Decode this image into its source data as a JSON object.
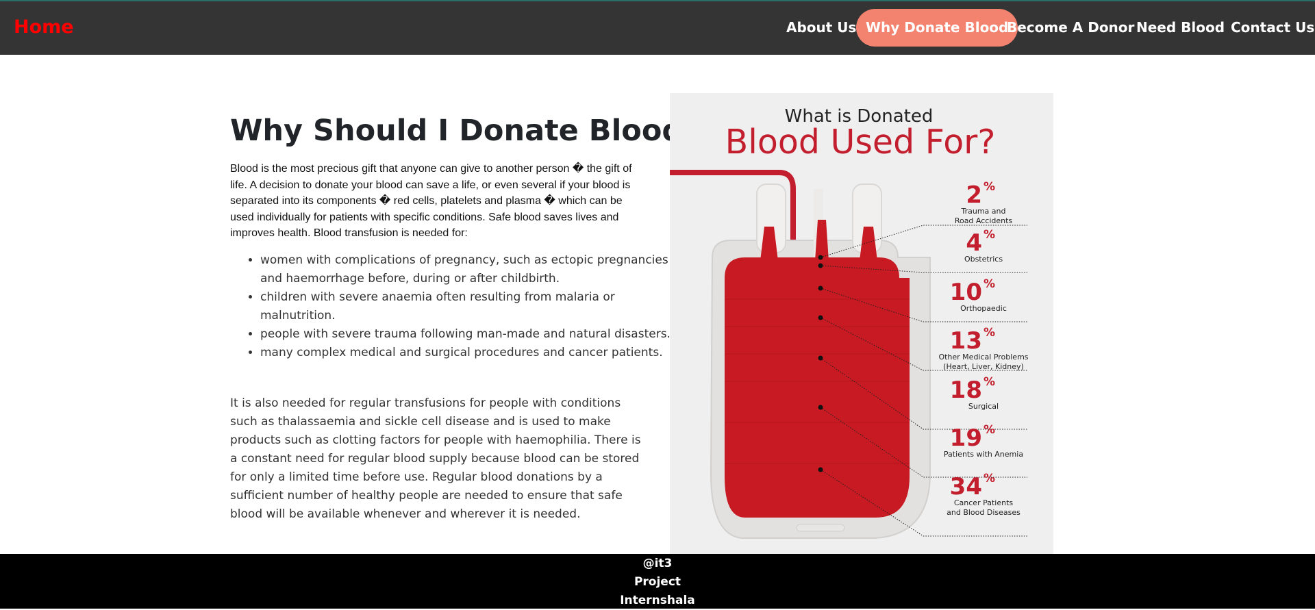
{
  "nav": {
    "brand": "Home",
    "items": [
      "About Us",
      "Why Donate Blood",
      "Become A Donor",
      "Need Blood",
      "Contact Us"
    ],
    "active": "Why Donate Blood"
  },
  "main": {
    "title": "Why Should I Donate Blood ?",
    "intro": "Blood is the most precious gift that anyone can give to another person � the gift of life. A decision to donate your blood can save a life, or even several if your blood is separated into its components � red cells, platelets and plasma � which can be used individually for patients with specific conditions. Safe blood saves lives and improves health. Blood transfusion is needed for:",
    "list": [
      "women with complications of pregnancy, such as ectopic pregnancies and haemorrhage before, during or after childbirth.",
      "children with severe anaemia often resulting from malaria or malnutrition.",
      "people with severe trauma following man-made and natural disasters.",
      "many complex medical and surgical procedures and cancer patients."
    ],
    "outro": "It is also needed for regular transfusions for people with conditions such as thalassaemia and sickle cell disease and is used to make products such as clotting factors for people with haemophilia. There is a constant need for regular blood supply because blood can be stored for only a limited time before use. Regular blood donations by a sufficient number of healthy people are needed to ensure that safe blood will be available whenever and wherever it is needed."
  },
  "infographic": {
    "heading_small": "What is Donated",
    "heading_large": "Blood Used For?",
    "stats": [
      {
        "value": "2",
        "label_lines": [
          "Trauma and",
          "Road Accidents"
        ]
      },
      {
        "value": "4",
        "label_lines": [
          "Obstetrics"
        ]
      },
      {
        "value": "10",
        "label_lines": [
          "Orthopaedic"
        ]
      },
      {
        "value": "13",
        "label_lines": [
          "Other Medical Problems",
          "(Heart, Liver, Kidney)"
        ]
      },
      {
        "value": "18",
        "label_lines": [
          "Surgical"
        ]
      },
      {
        "value": "19",
        "label_lines": [
          "Patients with Anemia"
        ]
      },
      {
        "value": "34",
        "label_lines": [
          "Cancer Patients",
          "and Blood Diseases"
        ]
      }
    ],
    "percent_symbol": "%",
    "colors": {
      "accent": "#c31e2e",
      "bag_fill": "#c81a22"
    }
  },
  "footer": {
    "lines": [
      "@it3",
      "Project",
      "Internshala"
    ]
  },
  "colors": {
    "navbar": "#343434",
    "brand": "#ff0000",
    "active_pill": "#f3826f",
    "footer": "#000000"
  }
}
